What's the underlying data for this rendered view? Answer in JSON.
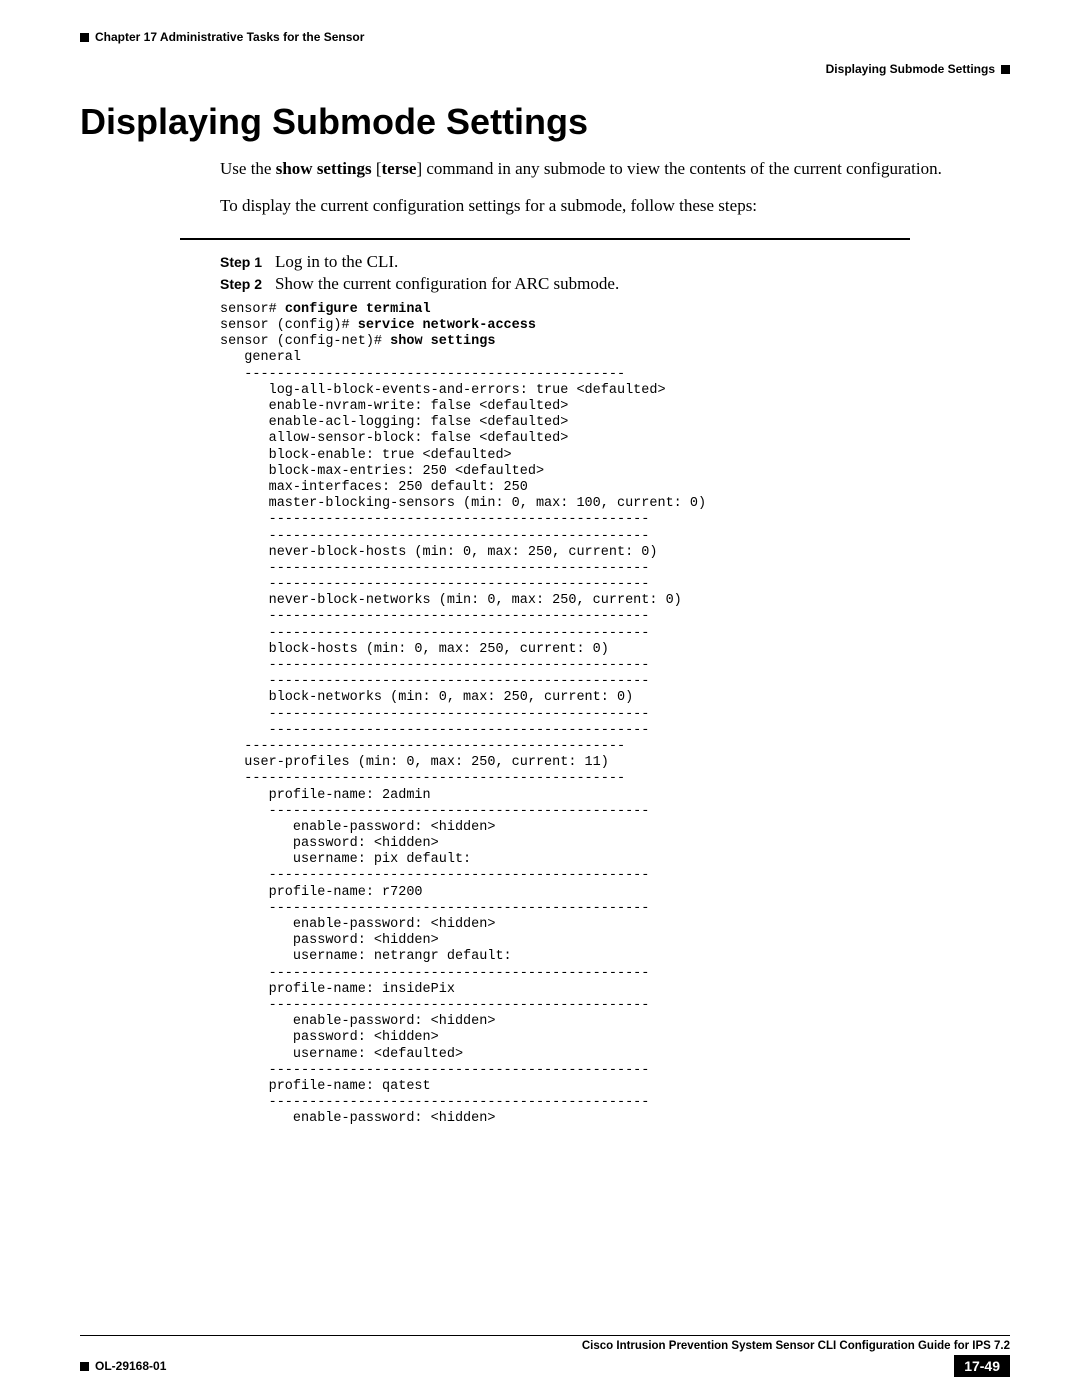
{
  "header": {
    "chapter_label": "Chapter 17    Administrative Tasks for the Sensor",
    "sub_header": "Displaying Submode Settings"
  },
  "heading": "Displaying Submode Settings",
  "intro": {
    "line1_a": "Use the ",
    "line1_b": "show settings",
    "line1_c": " [",
    "line1_d": "terse",
    "line1_e": "] command in any submode to view the contents of the current configuration.",
    "line2": "To display the current configuration settings for a submode, follow these steps:"
  },
  "steps": {
    "s1_label": "Step 1",
    "s1_text": "Log in to the CLI.",
    "s2_label": "Step 2",
    "s2_text": "Show the current configuration for ARC submode."
  },
  "code": {
    "l01a": "sensor# ",
    "l01b": "configure terminal",
    "l02a": "sensor (config)# ",
    "l02b": "service network-access",
    "l03a": "sensor (config-net)# ",
    "l03b": "show settings",
    "l04": "   general",
    "l05": "   -----------------------------------------------",
    "l06": "      log-all-block-events-and-errors: true <defaulted>",
    "l07": "      enable-nvram-write: false <defaulted>",
    "l08": "      enable-acl-logging: false <defaulted>",
    "l09": "      allow-sensor-block: false <defaulted>",
    "l10": "      block-enable: true <defaulted>",
    "l11": "      block-max-entries: 250 <defaulted>",
    "l12": "      max-interfaces: 250 default: 250",
    "l13": "      master-blocking-sensors (min: 0, max: 100, current: 0)",
    "l14": "      -----------------------------------------------",
    "l15": "      -----------------------------------------------",
    "l16": "      never-block-hosts (min: 0, max: 250, current: 0)",
    "l17": "      -----------------------------------------------",
    "l18": "      -----------------------------------------------",
    "l19": "      never-block-networks (min: 0, max: 250, current: 0)",
    "l20": "      -----------------------------------------------",
    "l21": "      -----------------------------------------------",
    "l22": "      block-hosts (min: 0, max: 250, current: 0)",
    "l23": "      -----------------------------------------------",
    "l24": "      -----------------------------------------------",
    "l25": "      block-networks (min: 0, max: 250, current: 0)",
    "l26": "      -----------------------------------------------",
    "l27": "      -----------------------------------------------",
    "l28": "   -----------------------------------------------",
    "l29": "   user-profiles (min: 0, max: 250, current: 11)",
    "l30": "   -----------------------------------------------",
    "l31": "      profile-name: 2admin",
    "l32": "      -----------------------------------------------",
    "l33": "         enable-password: <hidden>",
    "l34": "         password: <hidden>",
    "l35": "         username: pix default:",
    "l36": "      -----------------------------------------------",
    "l37": "      profile-name: r7200",
    "l38": "      -----------------------------------------------",
    "l39": "         enable-password: <hidden>",
    "l40": "         password: <hidden>",
    "l41": "         username: netrangr default:",
    "l42": "      -----------------------------------------------",
    "l43": "      profile-name: insidePix",
    "l44": "      -----------------------------------------------",
    "l45": "         enable-password: <hidden>",
    "l46": "         password: <hidden>",
    "l47": "         username: <defaulted>",
    "l48": "      -----------------------------------------------",
    "l49": "      profile-name: qatest",
    "l50": "      -----------------------------------------------",
    "l51": "         enable-password: <hidden>"
  },
  "footer": {
    "guide": "Cisco Intrusion Prevention System Sensor CLI Configuration Guide for IPS 7.2",
    "docnum": "OL-29168-01",
    "pagenum": "17-49"
  }
}
